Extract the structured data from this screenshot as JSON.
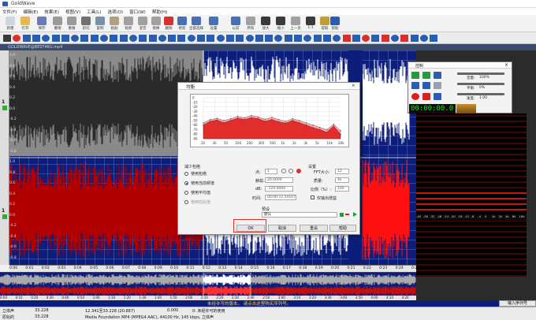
{
  "app": {
    "title": "GoldWave",
    "document_title": "GOLDWAVE@BEST4KU.mp4"
  },
  "menu": [
    "文件(F)",
    "编辑(E)",
    "效果(E)",
    "视图(V)",
    "工具(L)",
    "选项(O)",
    "窗口(W)",
    "帮助(H)"
  ],
  "toolbar": [
    {
      "label": "新建",
      "icon": "new-icon",
      "color": "#cfd6e0"
    },
    {
      "label": "打开",
      "icon": "open-icon",
      "color": "#e7b84a"
    },
    {
      "label": "保存",
      "icon": "save-icon",
      "color": "#6b7bb8"
    },
    {
      "label": "撤销",
      "icon": "undo-icon",
      "color": "#9a9a9a"
    },
    {
      "label": "重做",
      "icon": "redo-icon",
      "color": "#9a9a9a"
    },
    {
      "label": "剪切",
      "icon": "cut-icon",
      "color": "#707070"
    },
    {
      "label": "复制",
      "icon": "copy-icon",
      "color": "#7a8fb0"
    },
    {
      "label": "粘贴",
      "icon": "paste-icon",
      "color": "#b0a080"
    },
    {
      "label": "粘新",
      "icon": "paste-new-icon",
      "color": "#a0a0a0"
    },
    {
      "label": "混音",
      "icon": "mix-icon",
      "color": "#a0a0a0"
    },
    {
      "label": "替换",
      "icon": "replace-icon",
      "color": "#a0a0a0"
    },
    {
      "label": "删除",
      "icon": "delete-icon",
      "color": "#d83030"
    },
    {
      "label": "修剪",
      "icon": "trim-icon",
      "color": "#4a6fb8"
    },
    {
      "label": "全部选择",
      "icon": "select-all-icon",
      "color": "#4a6fb8"
    },
    {
      "label": "设置",
      "icon": "set-icon",
      "color": "#4a6fb8"
    },
    {
      "label": "以前",
      "icon": "previous-icon",
      "color": "#4a6fb8"
    },
    {
      "label": "所有",
      "icon": "all-icon",
      "color": "#a0a0a0"
    },
    {
      "label": "放大",
      "icon": "zoom-in-icon",
      "color": "#3a3a3a"
    },
    {
      "label": "缩小",
      "icon": "zoom-out-icon",
      "color": "#3a3a3a"
    },
    {
      "label": "上一页",
      "icon": "prev-page-icon",
      "color": "#a0a0a0"
    },
    {
      "label": "1:1",
      "icon": "zoom-1-1-icon",
      "color": "#3a3a3a"
    },
    {
      "label": "提取",
      "icon": "cue-icon",
      "color": "#c0a030"
    },
    {
      "label": "帮助",
      "icon": "help-icon",
      "color": "#2a5db0"
    }
  ],
  "ruler_ticks": [
    "0:00",
    "0:01",
    "0:02",
    "0:03",
    "0:04",
    "0:05",
    "0:06",
    "0:07",
    "0:08",
    "0:09",
    "0:10",
    "0:11",
    "0:12",
    "0:13",
    "0:14",
    "0:15",
    "0:16",
    "0:17",
    "0:18",
    "0:19",
    "0:20",
    "0:21",
    "0:22",
    "0:23",
    "0:24",
    "0:25"
  ],
  "overview_ticks": [
    "0:00",
    "0:10",
    "0:20",
    "0:30",
    "0:40",
    "0:50",
    "1:00",
    "1:10",
    "1:20",
    "1:30",
    "1:40",
    "1:50",
    "2:00",
    "2:10",
    "2:20",
    "2:30",
    "2:40",
    "2:50",
    "3:00",
    "3:10",
    "3:20",
    "3:30",
    "3:40",
    "3:50",
    "4:00",
    "4:10",
    "4:20"
  ],
  "channel_labels": {
    "top": "1",
    "bottom": "1"
  },
  "amp_labels": [
    "1.0",
    "0.8",
    "0.6",
    "0.4",
    "0.2",
    "0.0",
    "-0.2",
    "-0.4",
    "-0.6",
    "-0.8",
    "1.0",
    "0.8",
    "0.6",
    "0.4",
    "0.2",
    "0.0",
    "-0.2",
    "-0.4",
    "-0.6",
    "-0.8"
  ],
  "status": {
    "message": "未经许可的版本。 请点击这里购买序列号。",
    "register": "输入序列号",
    "left_label": "立体声",
    "left_value": "33.228",
    "sel_label": "12.341至33.228 (20.887)",
    "sel_value": "0.000",
    "mode_label": "0: 未经许可的使用",
    "dur_label": "原始的",
    "dur_value": "33.228",
    "format": "Media Foundation MP4 (MPEG4 AAC), 44100 Hz, 145 kbps, 立体声"
  },
  "control": {
    "title": "控制",
    "volume_label": "音量:",
    "volume_value": "100%",
    "balance_label": "平衡:",
    "balance_value": "0%",
    "speed_label": "速度:",
    "speed_value": "1.00",
    "time": "00:00:00.0",
    "meter_ticks": [
      "-40",
      "-36",
      "-32",
      "-28",
      "-24",
      "-20",
      "-16",
      "-12",
      "-8",
      "-4",
      "0",
      "1k",
      "2k",
      "4k",
      "8k",
      "16k"
    ]
  },
  "eq": {
    "title": "均衡",
    "chart_data": {
      "type": "area",
      "xlabel": "",
      "ylabel": "",
      "x_ticks": [
        "20",
        "30",
        "50",
        "100",
        "200",
        "300",
        "500",
        "1k",
        "2k",
        "3k",
        "5k",
        "10k",
        "20k"
      ],
      "y_ticks": [
        "0",
        "-10",
        "-20",
        "-30",
        "-40",
        "-50",
        "-60",
        "-70",
        "-80",
        "-90"
      ],
      "ylim": [
        -90,
        0
      ],
      "series": [
        {
          "values": [
            -55,
            -48,
            -45,
            -50,
            -46,
            -41,
            -44,
            -39,
            -42,
            -47,
            -43,
            -48,
            -52,
            -46,
            -50,
            -55,
            -60,
            -65,
            -70,
            -58,
            -72
          ]
        },
        {
          "values": [
            -60,
            -52,
            -49,
            -55,
            -50,
            -45,
            -48,
            -44,
            -46,
            -52,
            -48,
            -53,
            -56,
            -50,
            -55,
            -60,
            -66,
            -70,
            -76,
            -62,
            -80
          ]
        }
      ]
    },
    "section_label": "减少包络",
    "radios": [
      {
        "label": "使用包络",
        "on": false
      },
      {
        "label": "使用当前频谱",
        "on": true
      },
      {
        "label": "使用平均值",
        "on": false
      },
      {
        "label": "使用前后值",
        "on": false
      }
    ],
    "point_label": "点:",
    "point_value": "1",
    "hz_label": "赫兹:",
    "hz_value": "20.0000",
    "db_label": "dB:",
    "db_value": "-120.0000",
    "time_label": "时间:",
    "time_value": "00:00:12.54107",
    "settings_label": "设置",
    "fft_label": "FFT大小:",
    "fft_value": "12",
    "quality_label": "质量:",
    "quality_value": "4k",
    "ratio_label": "比例（%）:",
    "ratio_value": "100",
    "keep_label": "仅输出增益",
    "preset_label": "预设",
    "preset_value": "默认",
    "ok": "OK",
    "cancel": "取消",
    "apply": "重设",
    "help": "帮助"
  }
}
